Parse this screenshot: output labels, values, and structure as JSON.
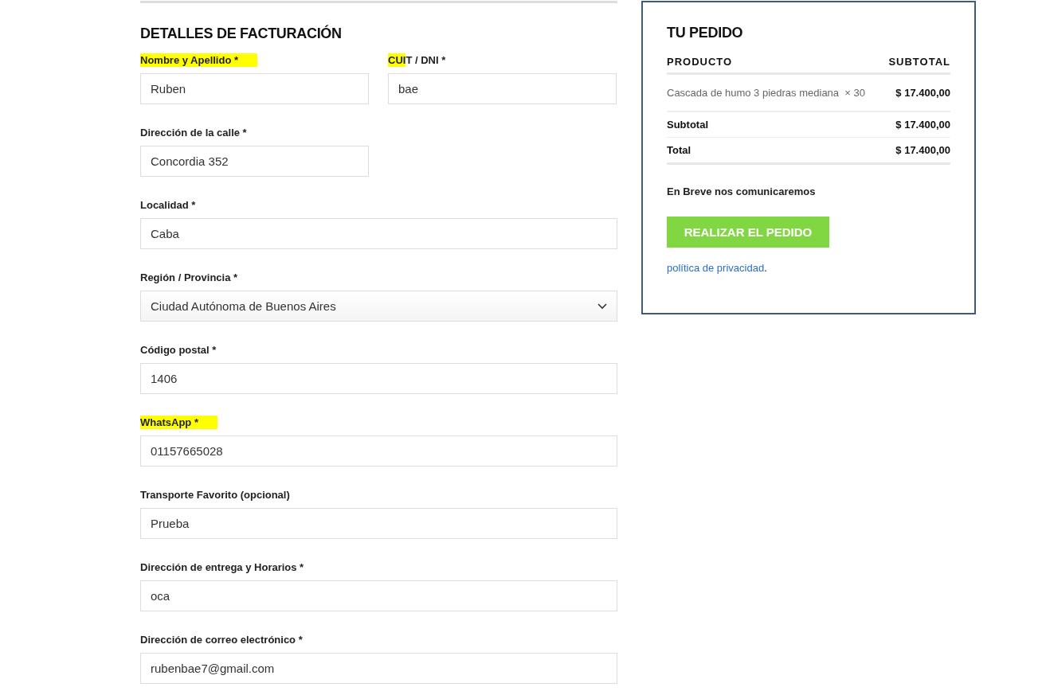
{
  "billing": {
    "title": "DETALLES DE FACTURACIÓN",
    "rows": [
      {
        "fields": [
          {
            "label": "Nombre y Apellido *",
            "kind": "text",
            "wide": false,
            "value": "Ruben",
            "highlighted": true,
            "highlight_partial": false
          },
          {
            "label": "CUIT / DNI *",
            "kind": "text",
            "wide": false,
            "value": "bae",
            "highlighted": true,
            "highlight_partial": true
          }
        ]
      },
      {
        "fields": [
          {
            "label": "Dirección de la calle *",
            "kind": "text",
            "wide": false,
            "value": "Concordia 352",
            "highlighted": false
          }
        ]
      },
      {
        "fields": [
          {
            "label": "Localidad *",
            "kind": "text",
            "wide": true,
            "value": "Caba",
            "highlighted": false
          }
        ]
      },
      {
        "fields": [
          {
            "label": "Región / Provincia *",
            "kind": "select",
            "wide": true,
            "value": "Ciudad Autónoma de Buenos Aires",
            "highlighted": false
          }
        ]
      },
      {
        "fields": [
          {
            "label": "Código postal *",
            "kind": "text",
            "wide": true,
            "value": "1406",
            "highlighted": false
          }
        ]
      },
      {
        "fields": [
          {
            "label": "WhatsApp *",
            "kind": "text",
            "wide": true,
            "value": "01157665028",
            "highlighted": true,
            "highlight_partial": false
          }
        ]
      },
      {
        "fields": [
          {
            "label": "Transporte Favorito (opcional)",
            "kind": "text",
            "wide": true,
            "value": "Prueba",
            "highlighted": false
          }
        ]
      },
      {
        "fields": [
          {
            "label": "Dirección de entrega y Horarios *",
            "kind": "text",
            "wide": true,
            "value": "oca",
            "highlighted": false
          }
        ]
      },
      {
        "fields": [
          {
            "label": "Dirección de correo electrónico *",
            "kind": "text",
            "wide": true,
            "value": "rubenbae7@gmail.com",
            "highlighted": false
          }
        ]
      }
    ]
  },
  "order": {
    "title": "TU PEDIDO",
    "columns": [
      "PRODUCTO",
      "SUBTOTAL"
    ],
    "items": [
      {
        "name": "Cascada de humo 3 piedras mediana",
        "quantity": "× 30",
        "total": "$ 17.400,00"
      }
    ],
    "totals": [
      {
        "label": "Subtotal",
        "value": "$ 17.400,00"
      },
      {
        "label": "Total",
        "value": "$ 17.400,00"
      }
    ],
    "note": "En Breve nos comunicaremos",
    "button": "REALIZAR EL PEDIDO",
    "privacy_link": "política de privacidad",
    "privacy_suffix": "."
  }
}
